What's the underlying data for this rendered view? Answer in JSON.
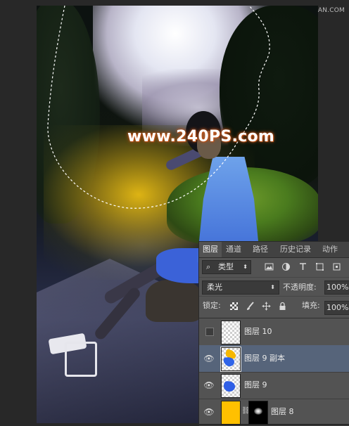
{
  "header": {
    "watermark": "思缘设计论坛 WWW.MISSYUAN.COM"
  },
  "canvas": {
    "watermark": "www.240PS.com"
  },
  "layers_panel": {
    "tabs": [
      {
        "label": "图层",
        "active": true
      },
      {
        "label": "通道"
      },
      {
        "label": "路径"
      },
      {
        "label": "历史记录"
      },
      {
        "label": "动作"
      }
    ],
    "filter": {
      "kind_label": "类型",
      "icons": [
        "image-filter-icon",
        "adjustment-filter-icon",
        "type-filter-icon",
        "shape-filter-icon",
        "smart-object-filter-icon"
      ]
    },
    "blend_mode": "柔光",
    "opacity_label": "不透明度:",
    "opacity_value": "100%",
    "lock_label": "锁定:",
    "lock_icons": [
      "lock-transparent-icon",
      "lock-brush-icon",
      "lock-move-icon",
      "lock-all-icon"
    ],
    "fill_label": "填充:",
    "fill_value": "100%",
    "layers": [
      {
        "name": "图层 10",
        "visible": false,
        "selected": false,
        "thumb": "transparent"
      },
      {
        "name": "图层 9 副本",
        "visible": true,
        "selected": true,
        "thumb": "orange-blue"
      },
      {
        "name": "图层 9",
        "visible": true,
        "selected": false,
        "thumb": "blue"
      },
      {
        "name": "图层 8",
        "visible": true,
        "selected": false,
        "thumb": "yellow-with-mask"
      }
    ]
  },
  "colors": {
    "panel_bg": "#535353",
    "selected_row": "#56647a",
    "watermark_glow": "#c3541a",
    "fill_yellow": "#ffc000"
  }
}
